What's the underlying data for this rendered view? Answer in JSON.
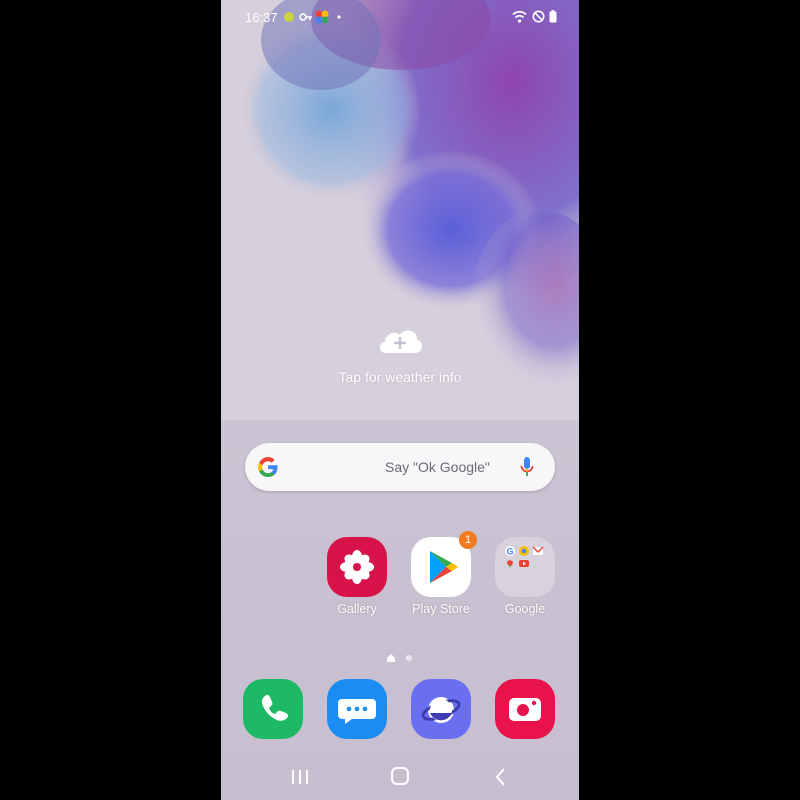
{
  "status_bar": {
    "time": "16:37",
    "icons": [
      "notification-dot-icon",
      "key-icon",
      "google-photos-icon",
      "dot-icon",
      "wifi-icon",
      "do-not-disturb-icon",
      "battery-icon"
    ]
  },
  "weather": {
    "label": "Tap for weather info",
    "icon": "cloud-add-icon"
  },
  "search": {
    "hint": "Say \"Ok Google\"",
    "logo": "google-g-icon",
    "mic": "mic-icon"
  },
  "apps": [
    {
      "label": "Gallery",
      "icon": "gallery-icon",
      "color": "#d8134a"
    },
    {
      "label": "Play Store",
      "icon": "play-store-icon",
      "badge": "1",
      "color": "#ffffff"
    },
    {
      "label": "Google",
      "icon": "google-folder-icon",
      "color": "#d7d2dc"
    }
  ],
  "page_indicator": {
    "pages": 2,
    "current": 1
  },
  "dock": [
    {
      "name": "phone",
      "icon": "phone-icon",
      "color": "#1db964"
    },
    {
      "name": "messages",
      "icon": "messages-icon",
      "color": "#1b8cf3"
    },
    {
      "name": "internet",
      "icon": "internet-icon",
      "color": "#6a6ff2"
    },
    {
      "name": "camera",
      "icon": "camera-icon",
      "color": "#e8134a"
    }
  ],
  "navigation": [
    "recents-icon",
    "home-icon",
    "back-icon"
  ],
  "colors": {
    "badge": "#f47a20",
    "wallpaper_purple": "#8a3fa8",
    "wallpaper_blue": "#6a6ee0"
  }
}
